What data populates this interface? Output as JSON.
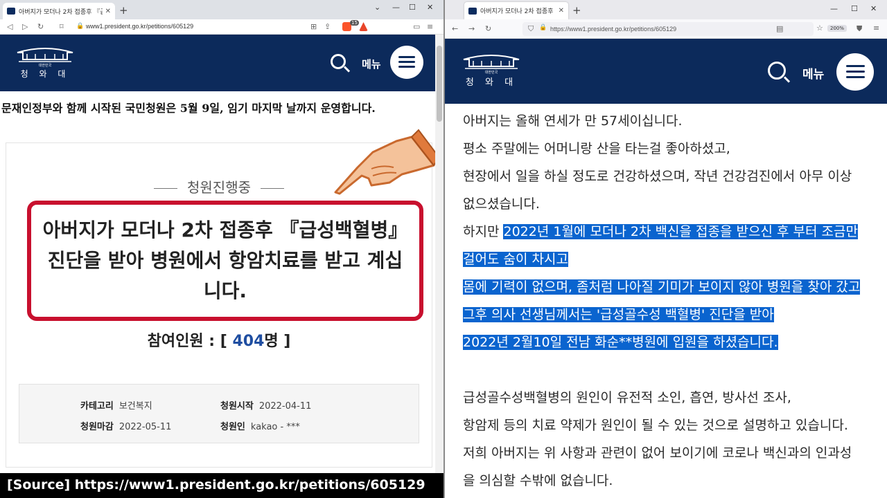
{
  "left_browser": {
    "tab_title": "아버지가 모더나 2차 접종후 『급성",
    "url": "www1.president.go.kr/petitions/605129",
    "ext_badge": "15"
  },
  "right_browser": {
    "tab_title": "아버지가 모더나 2차 접종후 『",
    "url": "https://www1.president.go.kr/petitions/605129",
    "zoom": "200%"
  },
  "site": {
    "logo_name": "청 와 대",
    "logo_sub": "대한민국",
    "menu_label": "메뉴"
  },
  "petition": {
    "banner": "문재인정부와 함께 시작된 국민청원은 5월 9일, 임기 마지막 날까지 운영합니다.",
    "status": "청원진행중",
    "title": "아버지가 모더나 2차 접종후 『급성백혈병』 진단을 받아 병원에서 항암치료를 받고 계십니다.",
    "participants_label": "참여인원 : [",
    "participants_count": "404",
    "participants_unit": "명 ]",
    "info": {
      "category_label": "카테고리",
      "category_value": "보건복지",
      "start_label": "청원시작",
      "start_value": "2022-04-11",
      "deadline_label": "청원마감",
      "deadline_value": "2022-05-11",
      "author_label": "청원인",
      "author_value": "kakao - ***"
    }
  },
  "source_caption": "[Source] https://www1.president.go.kr/petitions/605129",
  "body": {
    "lines": [
      {
        "plain": "아버지는 올해 연세가 만 57세이십니다.",
        "highlight": ""
      },
      {
        "plain": "평소 주말에는 어머니랑 산을 타는걸 좋아하셨고,",
        "highlight": ""
      },
      {
        "plain": "현장에서 일을 하실 정도로 건강하셨으며, 작년 건강검진에서 아무 이상",
        "highlight": ""
      },
      {
        "plain": "없으셨습니다.",
        "highlight": ""
      },
      {
        "plain": "하지만 ",
        "highlight": "2022년 1월에 모더나 2차 백신을 접종을 받으신 후 부터 조금만"
      },
      {
        "plain": "",
        "highlight": "걸어도 숨이 차시고"
      },
      {
        "plain": "",
        "highlight": "몸에 기력이 없으며, 좀처럼 나아질 기미가 보이지 않아 병원을 찾아 갔고"
      },
      {
        "plain": "",
        "highlight": "그후 의사 선생님께서는 '급성골수성 백혈병' 진단을 받아"
      },
      {
        "plain": "",
        "highlight": "2022년 2월10일 전남 화순**병원에 입원을 하셨습니다."
      },
      {
        "plain": "급성골수성백혈병의 원인이 유전적 소인, 흡연, 방사선 조사,",
        "highlight": ""
      },
      {
        "plain": "항암제 등의 치료 약제가 원인이 될 수 있는 것으로 설명하고 있습니다.",
        "highlight": ""
      },
      {
        "plain": "저희 아버지는 위 사항과 관련이 없어 보이기에 코로나 백신과의 인과성",
        "highlight": ""
      },
      {
        "plain": "을 의심할 수밖에 없습니다.",
        "highlight": ""
      }
    ]
  },
  "colors": {
    "header_navy": "#0c2a5b",
    "frame_red": "#c8102e",
    "count_blue": "#1f4ea1",
    "selection_blue": "#0a64cf"
  }
}
